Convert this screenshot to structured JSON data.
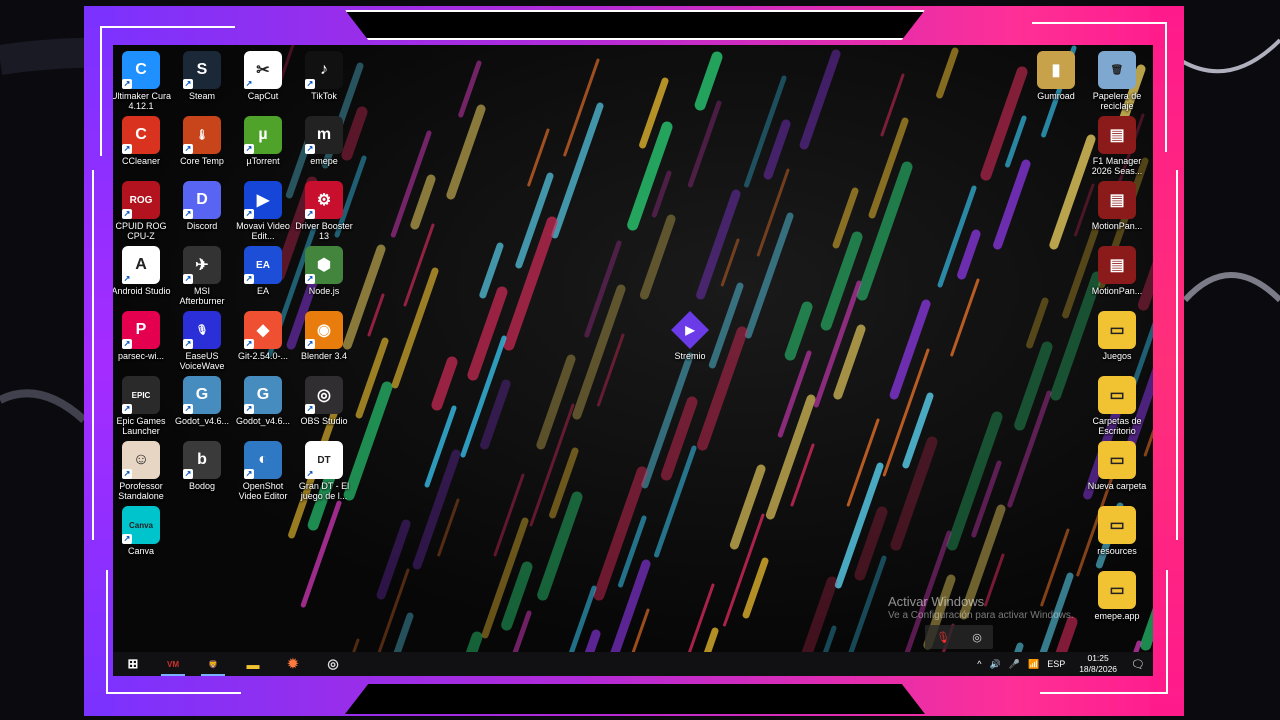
{
  "desktop": {
    "left_icons": [
      {
        "label": "Ultimaker Cura 4.12.1",
        "color": "#1e90ff",
        "glyph": "C"
      },
      {
        "label": "Steam",
        "color": "#1b2838",
        "glyph": "S"
      },
      {
        "label": "CapCut",
        "color": "#ffffff",
        "glyph": "✂"
      },
      {
        "label": "TikTok",
        "color": "#111111",
        "glyph": "♪"
      },
      {
        "label": "CCleaner",
        "color": "#d9331f",
        "glyph": "C"
      },
      {
        "label": "Core Temp",
        "color": "#c8441a",
        "glyph": "🌡"
      },
      {
        "label": "µTorrent",
        "color": "#4fa32a",
        "glyph": "µ"
      },
      {
        "label": "emepe",
        "color": "#222222",
        "glyph": "m"
      },
      {
        "label": "CPUID ROG CPU-Z",
        "color": "#b3121f",
        "glyph": "ROG"
      },
      {
        "label": "Discord",
        "color": "#5865f2",
        "glyph": "D"
      },
      {
        "label": "Movavi Video Edit...",
        "color": "#1546d8",
        "glyph": "▶"
      },
      {
        "label": "Driver Booster 13",
        "color": "#c8102e",
        "glyph": "⚙"
      },
      {
        "label": "Android Studio",
        "color": "#ffffff",
        "glyph": "A"
      },
      {
        "label": "MSI Afterburner",
        "color": "#333333",
        "glyph": "✈"
      },
      {
        "label": "EA",
        "color": "#1d4ed8",
        "glyph": "EA"
      },
      {
        "label": "Node.js",
        "color": "#43853d",
        "glyph": "⬢"
      },
      {
        "label": "parsec-wi...",
        "color": "#e5004f",
        "glyph": "P"
      },
      {
        "label": "EaseUS VoiceWave",
        "color": "#2b2fd8",
        "glyph": "🎙"
      },
      {
        "label": "Git-2.54.0-...",
        "color": "#f05032",
        "glyph": "◆"
      },
      {
        "label": "Blender 3.4",
        "color": "#e87d0d",
        "glyph": "◉"
      },
      {
        "label": "Epic Games Launcher",
        "color": "#2a2a2a",
        "glyph": "EPIC"
      },
      {
        "label": "Godot_v4.6...",
        "color": "#478cbf",
        "glyph": "G"
      },
      {
        "label": "Godot_v4.6...",
        "color": "#478cbf",
        "glyph": "G"
      },
      {
        "label": "OBS Studio",
        "color": "#302e31",
        "glyph": "◎"
      },
      {
        "label": "Porofessor Standalone",
        "color": "#e8d6c4",
        "glyph": "☺"
      },
      {
        "label": "Bodog",
        "color": "#3a3a3a",
        "glyph": "b"
      },
      {
        "label": "OpenShot Video Editor",
        "color": "#2f78c4",
        "glyph": "◐"
      },
      {
        "label": "Gran DT - El juego de l...",
        "color": "#ffffff",
        "glyph": "DT"
      },
      {
        "label": "Canva",
        "color": "#00c4cc",
        "glyph": "Canva"
      }
    ],
    "right_icons": [
      {
        "label": "Gumroad",
        "color": "#c8a24a",
        "glyph": "▮"
      },
      {
        "label": "Papelera de reciclaje",
        "color": "#7fa8d0",
        "glyph": "🗑"
      },
      {
        "label": "F1 Manager 2026 Seas...",
        "color": "#8b1a1a",
        "glyph": "▤"
      },
      {
        "label": "MotionPan...",
        "color": "#8b1a1a",
        "glyph": "▤"
      },
      {
        "label": "MotionPan...",
        "color": "#8b1a1a",
        "glyph": "▤"
      },
      {
        "label": "Juegos",
        "color": "#f1c232",
        "glyph": "▭"
      },
      {
        "label": "Carpetas de Escritorio",
        "color": "#f1c232",
        "glyph": "▭"
      },
      {
        "label": "Nueva carpeta",
        "color": "#f1c232",
        "glyph": "▭"
      },
      {
        "label": "resources",
        "color": "#f1c232",
        "glyph": "▭"
      },
      {
        "label": "emepe.app",
        "color": "#f1c232",
        "glyph": "▭"
      }
    ],
    "center_icon": {
      "label": "Stremio",
      "color": "#6c3be8",
      "glyph": "▶"
    }
  },
  "watermark": {
    "title": "Activar Windows",
    "subtitle": "Ve a Configuración para activar Windows."
  },
  "taskbar": {
    "apps": [
      {
        "name": "start-button",
        "glyph": "⊞",
        "color": "#ffffff"
      },
      {
        "name": "voicemeeter-icon",
        "glyph": "VM",
        "color": "#d0312d"
      },
      {
        "name": "brave-icon",
        "glyph": "🦁",
        "color": "#fb542b"
      },
      {
        "name": "file-explorer-icon",
        "glyph": "▬",
        "color": "#f1c232"
      },
      {
        "name": "settings-sun-icon",
        "glyph": "✹",
        "color": "#ff7a3d"
      },
      {
        "name": "screen-recorder-icon",
        "glyph": "◎",
        "color": "#dddddd"
      }
    ],
    "language": "ESP",
    "time": "01:25",
    "date": "18/8/2026"
  }
}
